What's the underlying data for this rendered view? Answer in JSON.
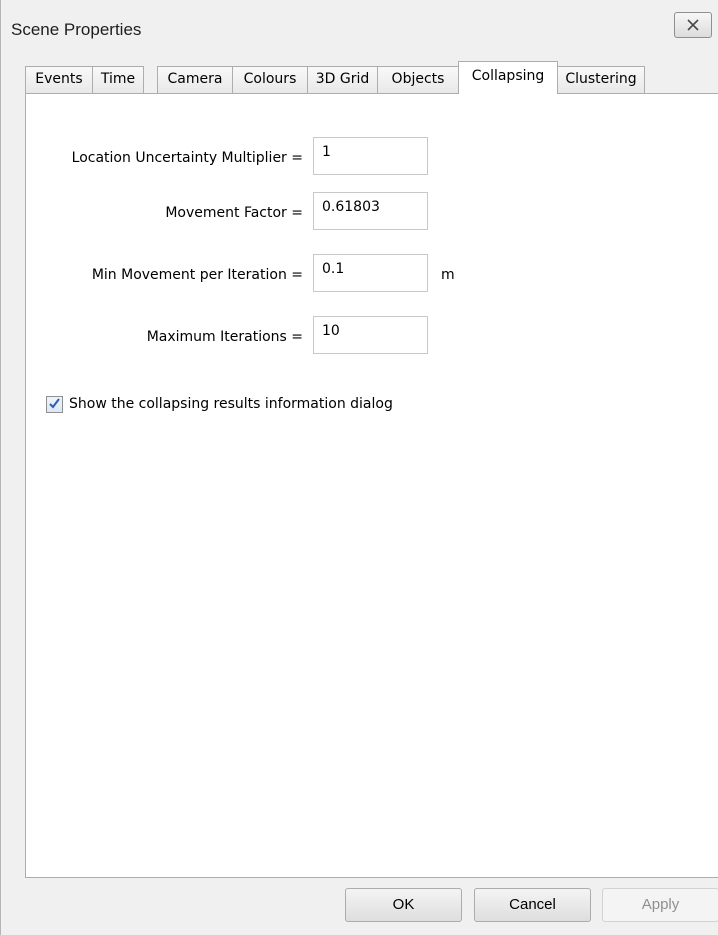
{
  "window": {
    "title": "Scene Properties"
  },
  "tabs": [
    {
      "label": "Events"
    },
    {
      "label": "Time"
    },
    {
      "label": "Camera"
    },
    {
      "label": "Colours"
    },
    {
      "label": "3D Grid"
    },
    {
      "label": "Objects"
    },
    {
      "label": "Collapsing",
      "active": true
    },
    {
      "label": "Clustering"
    }
  ],
  "collapsing": {
    "fields": [
      {
        "label": "Location Uncertainty Multiplier =",
        "value": "1"
      },
      {
        "label": "Movement Factor =",
        "value": "0.61803"
      },
      {
        "label": "Min Movement per Iteration =",
        "value": "0.1",
        "unit": "m"
      },
      {
        "label": "Maximum Iterations =",
        "value": "10"
      }
    ],
    "show_results_dialog": {
      "label": "Show the collapsing results information dialog",
      "checked": true
    }
  },
  "buttons": {
    "ok": "OK",
    "cancel": "Cancel",
    "apply": "Apply"
  },
  "icons": {
    "close": "close-icon",
    "check": "checkmark-icon"
  },
  "colors": {
    "background": "#f0f0f0",
    "panel": "#ffffff",
    "check": "#2a5fb0",
    "disabled_text": "#8f8f8f"
  }
}
